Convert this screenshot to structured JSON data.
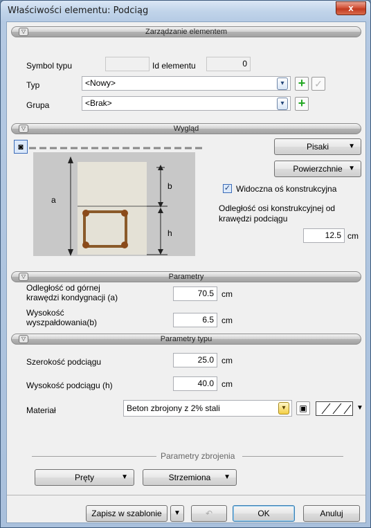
{
  "window": {
    "title": "Właściwości elementu: Podciąg",
    "close_label": "x"
  },
  "sections": {
    "management": "Zarządzanie elementem",
    "appearance": "Wygląd",
    "parameters": "Parametry",
    "type_parameters": "Parametry typu",
    "reinforcement": "Parametry zbrojenia"
  },
  "management": {
    "symbol_label": "Symbol typu",
    "symbol_value": "",
    "id_label": "Id elementu",
    "id_value": "0",
    "type_label": "Typ",
    "type_value": "<Nowy>",
    "group_label": "Grupa",
    "group_value": "<Brak>"
  },
  "appearance": {
    "pens_button": "Pisaki",
    "surfaces_button": "Powierzchnie",
    "axis_checkbox_label": "Widoczna oś konstrukcyjna",
    "axis_checked": true,
    "axis_offset_label_1": "Odległość osi konstrukcyjnej od",
    "axis_offset_label_2": "krawędzi podciągu",
    "axis_offset_value": "12.5",
    "axis_offset_unit": "cm",
    "diagram": {
      "label_a": "a",
      "label_b": "b",
      "label_h": "h"
    }
  },
  "parameters": {
    "offset_label_1": "Odległość od górnej",
    "offset_label_2": "krawędzi kondygnacji (a)",
    "offset_value": "70.5",
    "offset_unit": "cm",
    "height_label_1": "Wysokość",
    "height_label_2": "wyszpałdowania(b)",
    "height_value": "6.5",
    "height_unit": "cm"
  },
  "type_parameters": {
    "width_label": "Szerokość podciągu",
    "width_value": "25.0",
    "width_unit": "cm",
    "depth_label": "Wysokość podciągu (h)",
    "depth_value": "40.0",
    "depth_unit": "cm",
    "material_label": "Materiał",
    "material_value": "Beton zbrojony z 2% stali"
  },
  "reinforcement": {
    "bars_button": "Pręty",
    "stirrups_button": "Strzemiona"
  },
  "footer": {
    "save_template": "Zapisz w szablonie",
    "ok": "OK",
    "cancel": "Anuluj"
  }
}
